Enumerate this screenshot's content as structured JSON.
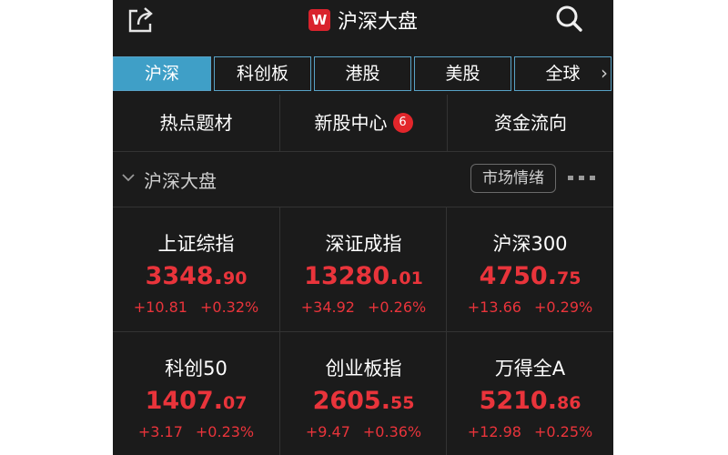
{
  "header": {
    "title": "沪深大盘",
    "brand_letter": "W",
    "share_icon": "share-icon",
    "search_icon": "search-icon"
  },
  "tabs": [
    {
      "label": "沪深",
      "active": true
    },
    {
      "label": "科创板",
      "active": false
    },
    {
      "label": "港股",
      "active": false
    },
    {
      "label": "美股",
      "active": false
    },
    {
      "label": "全球",
      "active": false
    }
  ],
  "tabs_more": "›",
  "quick_links": [
    {
      "label": "热点题材"
    },
    {
      "label": "新股中心",
      "badge": "6"
    },
    {
      "label": "资金流向"
    }
  ],
  "section": {
    "title": "沪深大盘",
    "sentiment_button": "市场情绪"
  },
  "indices": [
    {
      "name": "上证综指",
      "value_int": "3348.",
      "value_dec": "90",
      "change": "+10.81",
      "pct": "+0.32%"
    },
    {
      "name": "深证成指",
      "value_int": "13280.",
      "value_dec": "01",
      "change": "+34.92",
      "pct": "+0.26%"
    },
    {
      "name": "沪深300",
      "value_int": "4750.",
      "value_dec": "75",
      "change": "+13.66",
      "pct": "+0.29%"
    },
    {
      "name": "科创50",
      "value_int": "1407.",
      "value_dec": "07",
      "change": "+3.17",
      "pct": "+0.23%"
    },
    {
      "name": "创业板指",
      "value_int": "2605.",
      "value_dec": "55",
      "change": "+9.47",
      "pct": "+0.36%"
    },
    {
      "name": "万得全A",
      "value_int": "5210.",
      "value_dec": "86",
      "change": "+12.98",
      "pct": "+0.25%"
    }
  ],
  "colors": {
    "background": "#1b1b1b",
    "tab_active": "#3f9fc7",
    "tab_border": "#58a2c6",
    "up_red": "#e9343b",
    "brand_red": "#d9232d",
    "badge_red": "#e3262b"
  }
}
